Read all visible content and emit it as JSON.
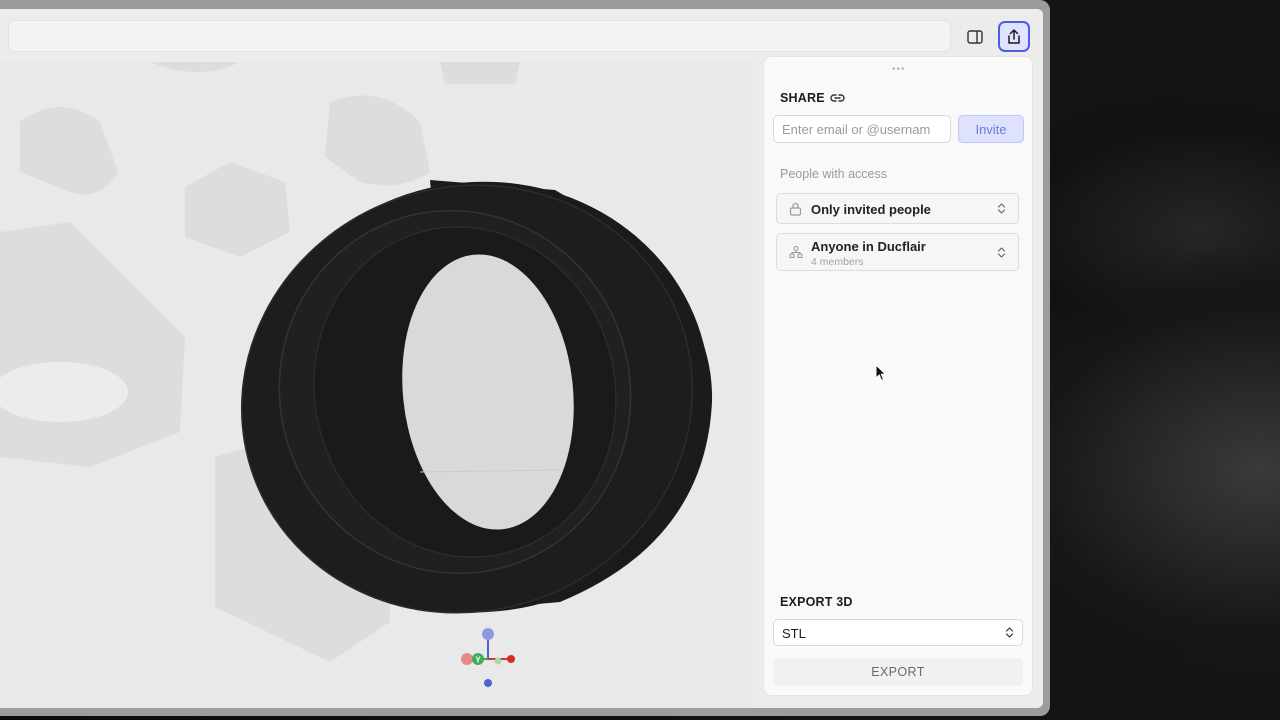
{
  "toolbar": {
    "address_value": "",
    "panel_toggle_icon": "sidebar-panel-icon",
    "share_icon": "share-upload-icon",
    "accent": "#4b5fe0"
  },
  "share": {
    "title": "SHARE",
    "link_icon": "link-icon",
    "invite_placeholder": "Enter email or @usernam",
    "invite_label": "Invite",
    "people_label": "People with access",
    "access_options": [
      {
        "label": "Only invited people",
        "icon": "lock-icon"
      },
      {
        "label": "Anyone in Ducflair",
        "sub": "4 members",
        "icon": "team-icon"
      }
    ]
  },
  "export": {
    "title": "EXPORT 3D",
    "format": "STL",
    "button_label": "EXPORT"
  },
  "viewport": {
    "model_color": "#1c1c1c",
    "axis_colors": {
      "x": "#d43434",
      "y": "#2fa84a",
      "z": "#4d60d6"
    },
    "axis_labels": {
      "y": "Y"
    }
  }
}
